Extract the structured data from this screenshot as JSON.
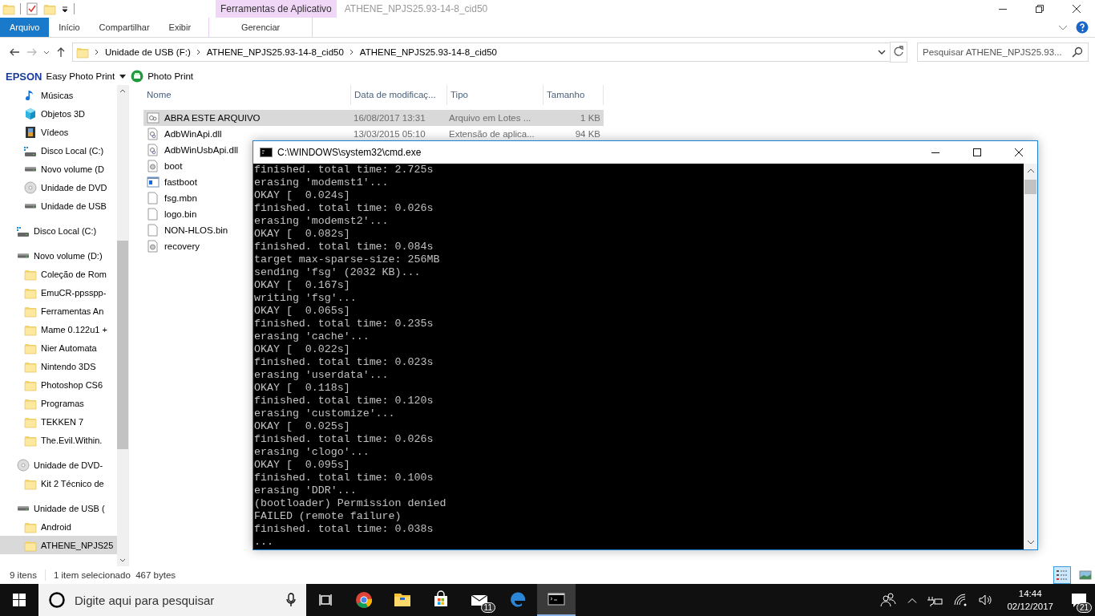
{
  "window": {
    "title": "ATHENE_NPJS25.93-14-8_cid50",
    "context_tab": "Ferramentas de Aplicativo"
  },
  "ribbon_tabs": [
    {
      "label": "Arquivo",
      "kind": "file",
      "selected": false
    },
    {
      "label": "Início",
      "kind": "tab",
      "selected": false
    },
    {
      "label": "Compartilhar",
      "kind": "tab",
      "selected": false
    },
    {
      "label": "Exibir",
      "kind": "tab",
      "selected": false
    },
    {
      "label": "Gerenciar",
      "kind": "context",
      "selected": false
    }
  ],
  "address": {
    "crumbs": [
      "Unidade de USB (F:)",
      "ATHENE_NPJS25.93-14-8_cid50",
      "ATHENE_NPJS25.93-14-8_cid50"
    ],
    "search_placeholder": "Pesquisar ATHENE_NPJS25.93..."
  },
  "toolbar": {
    "brand": "EPSON",
    "app": "Easy Photo Print",
    "photo_print": "Photo Print"
  },
  "sidebar": {
    "nested_items": [
      {
        "label": "Músicas",
        "kind": "music",
        "selected": false
      },
      {
        "label": "Objetos 3D",
        "kind": "cube",
        "selected": false
      },
      {
        "label": "Vídeos",
        "kind": "film",
        "selected": false
      },
      {
        "label": "Disco Local (C:)",
        "kind": "osdrive",
        "selected": false
      },
      {
        "label": "Novo volume (D",
        "kind": "drive",
        "selected": false
      },
      {
        "label": "Unidade de DVD",
        "kind": "dvd",
        "selected": false
      },
      {
        "label": "Unidade de USB",
        "kind": "drive",
        "selected": false
      }
    ],
    "tree": [
      {
        "label": "Disco Local (C:)",
        "kind": "osdrive",
        "selected": false
      },
      {
        "label": "Novo volume (D:)",
        "kind": "drive",
        "selected": false,
        "children": [
          {
            "label": "Coleção de Rom",
            "kind": "folder",
            "selected": false
          },
          {
            "label": "EmuCR-ppsspp-",
            "kind": "folder",
            "selected": false
          },
          {
            "label": "Ferramentas An",
            "kind": "folder",
            "selected": false
          },
          {
            "label": "Mame 0.122u1 +",
            "kind": "folder",
            "selected": false
          },
          {
            "label": "Nier Automata",
            "kind": "folder",
            "selected": false
          },
          {
            "label": "Nintendo 3DS",
            "kind": "folder",
            "selected": false
          },
          {
            "label": "Photoshop CS6",
            "kind": "folder",
            "selected": false
          },
          {
            "label": "Programas",
            "kind": "folder",
            "selected": false
          },
          {
            "label": "TEKKEN 7",
            "kind": "folder",
            "selected": false
          },
          {
            "label": "The.Evil.Within.",
            "kind": "folder",
            "selected": false
          }
        ]
      },
      {
        "label": "Unidade de DVD-",
        "kind": "dvd",
        "selected": false,
        "children": [
          {
            "label": "Kit 2 Técnico de",
            "kind": "folder",
            "selected": false
          }
        ]
      },
      {
        "label": "Unidade de USB (",
        "kind": "drive",
        "selected": false,
        "children": [
          {
            "label": "Android",
            "kind": "folder",
            "selected": false
          },
          {
            "label": "ATHENE_NPJS25",
            "kind": "folder",
            "selected": true
          }
        ]
      }
    ]
  },
  "table": {
    "columns": [
      "Nome",
      "Data de modificaç...",
      "Tipo",
      "Tamanho"
    ],
    "rows": [
      {
        "name": "ABRA ESTE ARQUIVO",
        "kind": "batch",
        "date": "16/08/2017 13:31",
        "type": "Arquivo em Lotes ...",
        "size": "1 KB",
        "selected": true
      },
      {
        "name": "AdbWinApi.dll",
        "kind": "dll",
        "date": "13/03/2015 05:10",
        "type": "Extensão de aplica...",
        "size": "94 KB",
        "selected": false
      },
      {
        "name": "AdbWinUsbApi.dll",
        "kind": "dll",
        "selected": false
      },
      {
        "name": "boot",
        "kind": "image",
        "selected": false
      },
      {
        "name": "fastboot",
        "kind": "exe",
        "selected": false
      },
      {
        "name": "fsg.mbn",
        "kind": "blank",
        "selected": false
      },
      {
        "name": "logo.bin",
        "kind": "blank",
        "selected": false
      },
      {
        "name": "NON-HLOS.bin",
        "kind": "blank",
        "selected": false
      },
      {
        "name": "recovery",
        "kind": "image",
        "selected": false
      }
    ]
  },
  "status_bar": {
    "count": "9 itens",
    "selection": "1 item selecionado  467 bytes"
  },
  "console": {
    "title": "C:\\WINDOWS\\system32\\cmd.exe",
    "lines": [
      "finished. total time: 2.725s",
      "erasing 'modemst1'...",
      "OKAY [  0.024s]",
      "finished. total time: 0.026s",
      "erasing 'modemst2'...",
      "OKAY [  0.082s]",
      "finished. total time: 0.084s",
      "target max-sparse-size: 256MB",
      "sending 'fsg' (2032 KB)...",
      "OKAY [  0.167s]",
      "writing 'fsg'...",
      "OKAY [  0.065s]",
      "finished. total time: 0.235s",
      "erasing 'cache'...",
      "OKAY [  0.022s]",
      "finished. total time: 0.023s",
      "erasing 'userdata'...",
      "OKAY [  0.118s]",
      "finished. total time: 0.120s",
      "erasing 'customize'...",
      "OKAY [  0.025s]",
      "finished. total time: 0.026s",
      "erasing 'clogo'...",
      "OKAY [  0.095s]",
      "finished. total time: 0.100s",
      "erasing 'DDR'...",
      "(bootloader) Permission denied",
      "FAILED (remote failure)",
      "finished. total time: 0.038s",
      "..."
    ]
  },
  "taskbar": {
    "search_placeholder": "Digite aqui para pesquisar",
    "apps": [
      {
        "kind": "taskview",
        "active": false
      },
      {
        "kind": "chrome",
        "active": false
      },
      {
        "kind": "explorer",
        "active": false
      },
      {
        "kind": "store",
        "active": false
      },
      {
        "kind": "mail",
        "active": false,
        "badge": "11"
      },
      {
        "kind": "edge",
        "active": false
      },
      {
        "kind": "console",
        "active": true
      }
    ],
    "time": "14:44",
    "date": "02/12/2017",
    "notifications": "21"
  }
}
